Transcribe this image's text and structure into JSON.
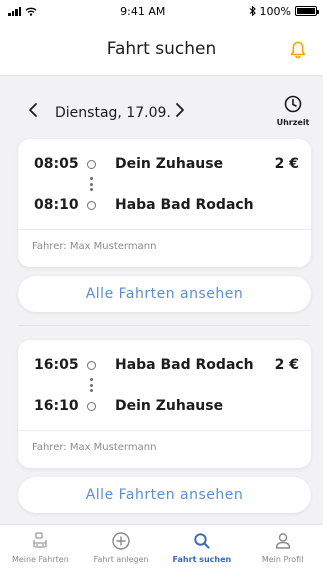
{
  "status_bar": {
    "time": "9:41 AM",
    "battery": "100%"
  },
  "header": {
    "title": "Fahrt suchen"
  },
  "date_nav": {
    "date": "Dienstag, 17.09.",
    "time_button_label": "Uhrzeit"
  },
  "trips": [
    {
      "depart_time": "08:05",
      "depart_stop": "Dein Zuhause",
      "arrive_time": "08:10",
      "arrive_stop": "Haba Bad Rodach",
      "price": "2 €",
      "driver": "Fahrer: Max Mustermann",
      "all_rides_label": "Alle Fahrten ansehen"
    },
    {
      "depart_time": "16:05",
      "depart_stop": "Haba Bad Rodach",
      "arrive_time": "16:10",
      "arrive_stop": "Dein Zuhause",
      "price": "2 €",
      "driver": "Fahrer: Max Mustermann",
      "all_rides_label": "Alle Fahrten ansehen"
    }
  ],
  "tabbar": {
    "items": [
      {
        "label": "Meine Fahrten",
        "icon": "car-seat-icon",
        "active": false
      },
      {
        "label": "Fahrt anlegen",
        "icon": "plus-circle-icon",
        "active": false
      },
      {
        "label": "Fahrt suchen",
        "icon": "search-icon",
        "active": true
      },
      {
        "label": "Mein Profil",
        "icon": "user-icon",
        "active": false
      }
    ]
  },
  "colors": {
    "accent": "#3569b8",
    "link": "#5b8fd1",
    "bell": "#f0a500"
  }
}
